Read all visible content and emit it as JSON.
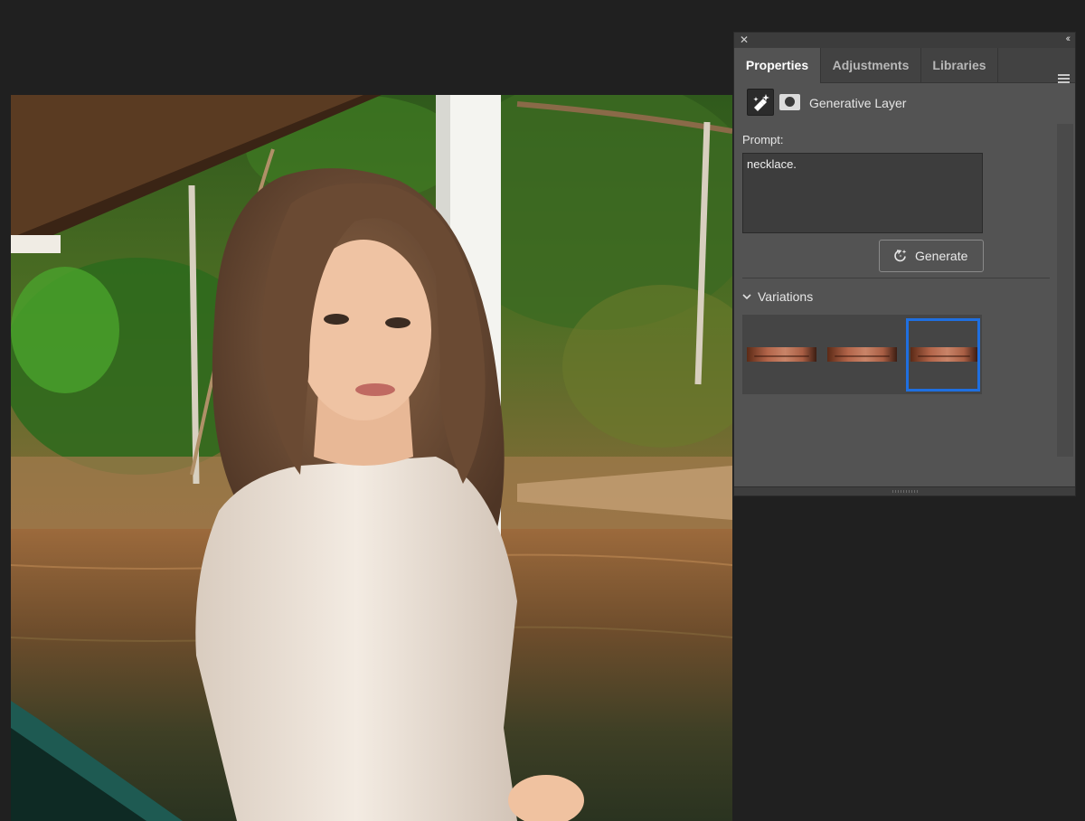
{
  "panel": {
    "close_icon": "close-icon",
    "collapse_icon": "collapse-icon",
    "tabs": [
      {
        "label": "Properties",
        "active": true
      },
      {
        "label": "Adjustments",
        "active": false
      },
      {
        "label": "Libraries",
        "active": false
      }
    ],
    "menu_icon": "hamburger-menu-icon",
    "layer": {
      "type_icon": "generative-layer-icon",
      "mask_icon": "layer-mask-icon",
      "name": "Generative Layer"
    },
    "prompt": {
      "label": "Prompt:",
      "value": "necklace."
    },
    "generate": {
      "label": "Generate",
      "icon": "generate-sparkle-icon"
    },
    "variations": {
      "label": "Variations",
      "expanded": true,
      "items": [
        {
          "name": "variation-1",
          "selected": false
        },
        {
          "name": "variation-2",
          "selected": false
        },
        {
          "name": "variation-3",
          "selected": true
        }
      ],
      "selection_color": "#1f6fe0"
    }
  },
  "colors": {
    "app_background": "#202020",
    "panel_background": "#535353",
    "tab_bar": "#424242"
  }
}
